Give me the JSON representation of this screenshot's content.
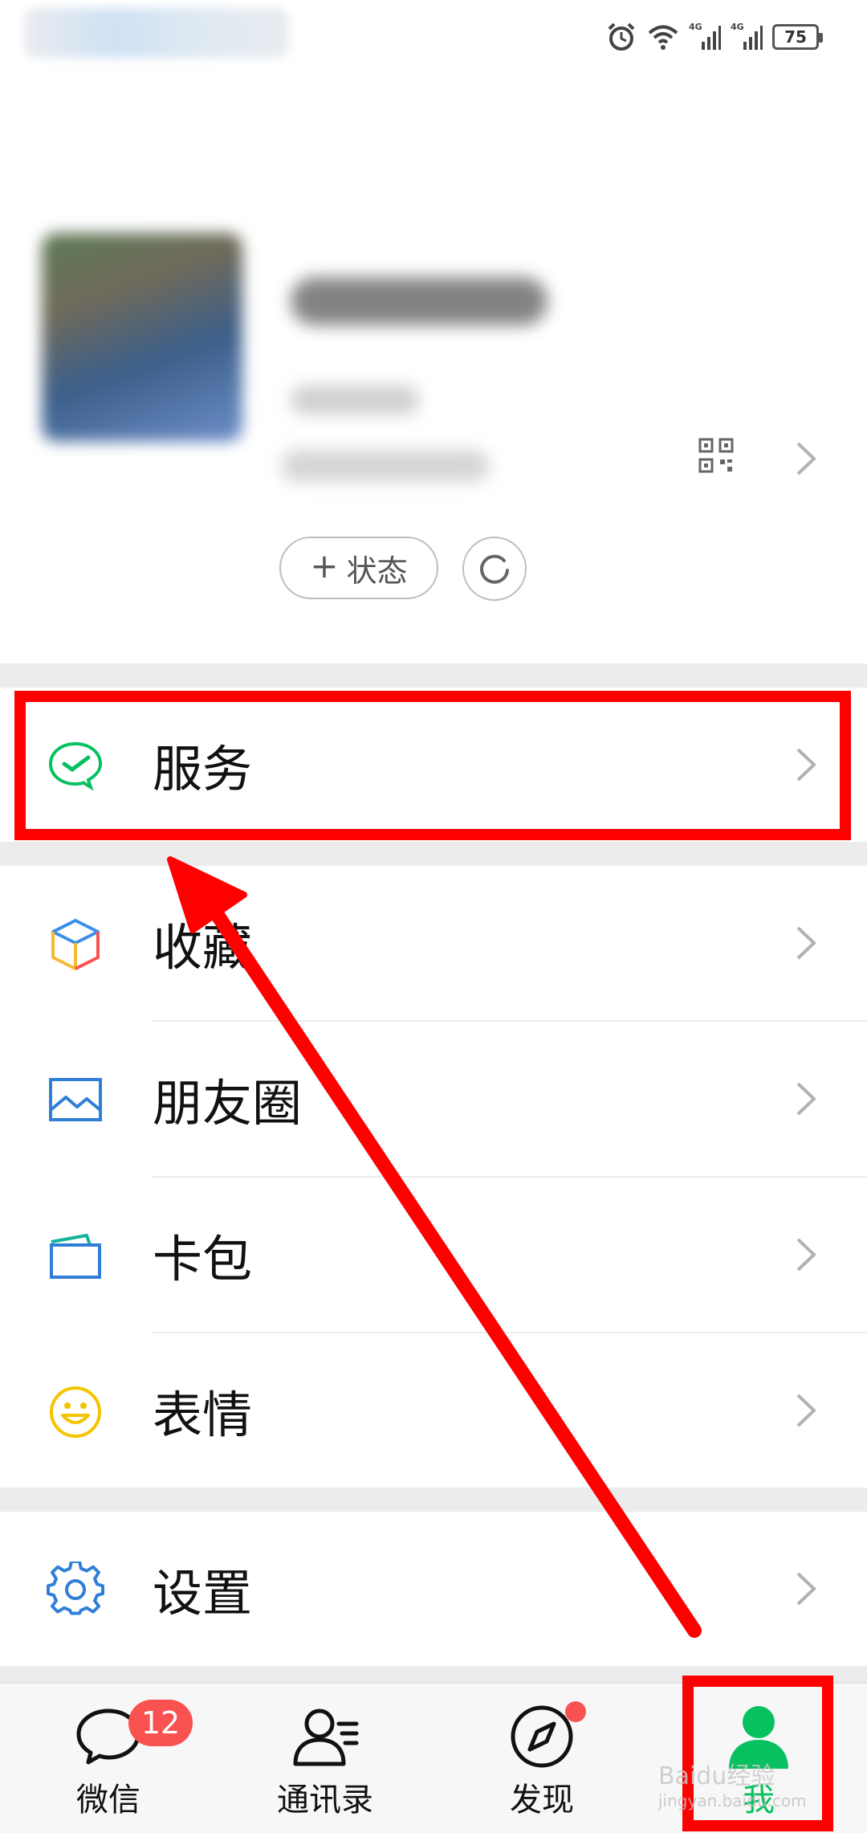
{
  "status_bar": {
    "network1": "4G",
    "network2": "4G",
    "battery": "75"
  },
  "profile": {
    "status_button_label": "状态"
  },
  "menu": [
    {
      "label": "服务",
      "icon": "wechat-pay-icon"
    },
    {
      "label": "收藏",
      "icon": "cube-favorites-icon"
    },
    {
      "label": "朋友圈",
      "icon": "image-moments-icon"
    },
    {
      "label": "卡包",
      "icon": "card-wallet-icon"
    },
    {
      "label": "表情",
      "icon": "smiley-icon"
    },
    {
      "label": "设置",
      "icon": "gear-icon"
    }
  ],
  "nav": {
    "tabs": [
      {
        "label": "微信",
        "icon": "chat-bubble-icon"
      },
      {
        "label": "通讯录",
        "icon": "contacts-icon"
      },
      {
        "label": "发现",
        "icon": "compass-icon"
      },
      {
        "label": "我",
        "icon": "person-icon"
      }
    ],
    "chats_badge": "12",
    "active_tab": "我"
  },
  "colors": {
    "accent": "#07c160",
    "badge": "#fa5151",
    "annotation": "#ff0000"
  },
  "watermark": {
    "title": "Baidu经验",
    "sub": "jingyan.baidu.com"
  }
}
